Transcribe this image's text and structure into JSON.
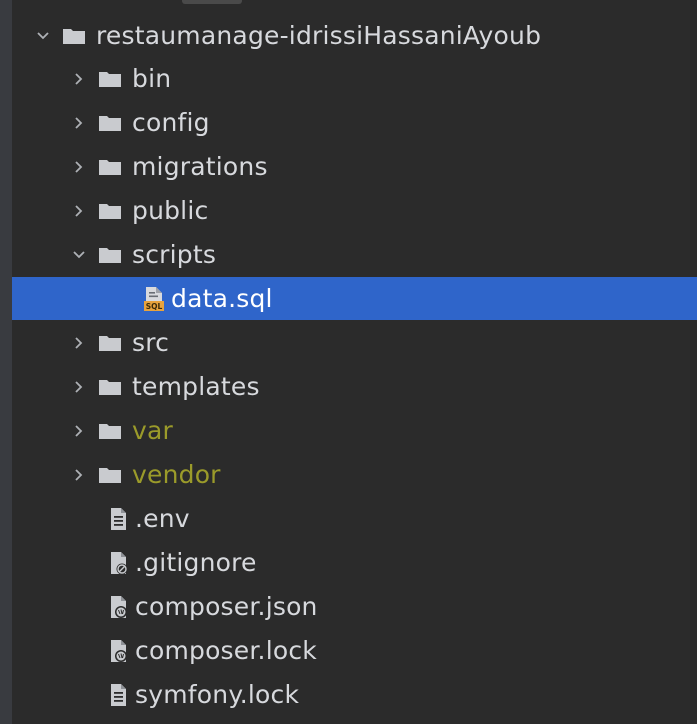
{
  "tree": {
    "root": {
      "label": "restaumanage-idrissiHassaniAyoub",
      "expanded": true
    },
    "items": [
      {
        "label": "bin",
        "kind": "folder",
        "expanded": false,
        "excluded": false
      },
      {
        "label": "config",
        "kind": "folder",
        "expanded": false,
        "excluded": false
      },
      {
        "label": "migrations",
        "kind": "folder",
        "expanded": false,
        "excluded": false
      },
      {
        "label": "public",
        "kind": "folder",
        "expanded": false,
        "excluded": false
      },
      {
        "label": "scripts",
        "kind": "folder",
        "expanded": true,
        "excluded": false
      },
      {
        "label": "data.sql",
        "kind": "file",
        "icon": "sql-file-icon",
        "selected": true
      },
      {
        "label": "src",
        "kind": "folder",
        "expanded": false,
        "excluded": false
      },
      {
        "label": "templates",
        "kind": "folder",
        "expanded": false,
        "excluded": false
      },
      {
        "label": "var",
        "kind": "folder",
        "expanded": false,
        "excluded": true
      },
      {
        "label": "vendor",
        "kind": "folder",
        "expanded": false,
        "excluded": true
      },
      {
        "label": ".env",
        "kind": "file",
        "icon": "text-file-icon"
      },
      {
        "label": ".gitignore",
        "kind": "file",
        "icon": "ignore-file-icon"
      },
      {
        "label": "composer.json",
        "kind": "file",
        "icon": "composer-file-icon"
      },
      {
        "label": "composer.lock",
        "kind": "file",
        "icon": "composer-file-icon"
      },
      {
        "label": "symfony.lock",
        "kind": "file",
        "icon": "text-file-icon"
      }
    ]
  },
  "colors": {
    "background": "#2b2b2b",
    "text": "#d7d9dd",
    "selection": "#2f65ca",
    "excluded_text": "#9b9b2a",
    "folder": "#c9cbcf"
  }
}
